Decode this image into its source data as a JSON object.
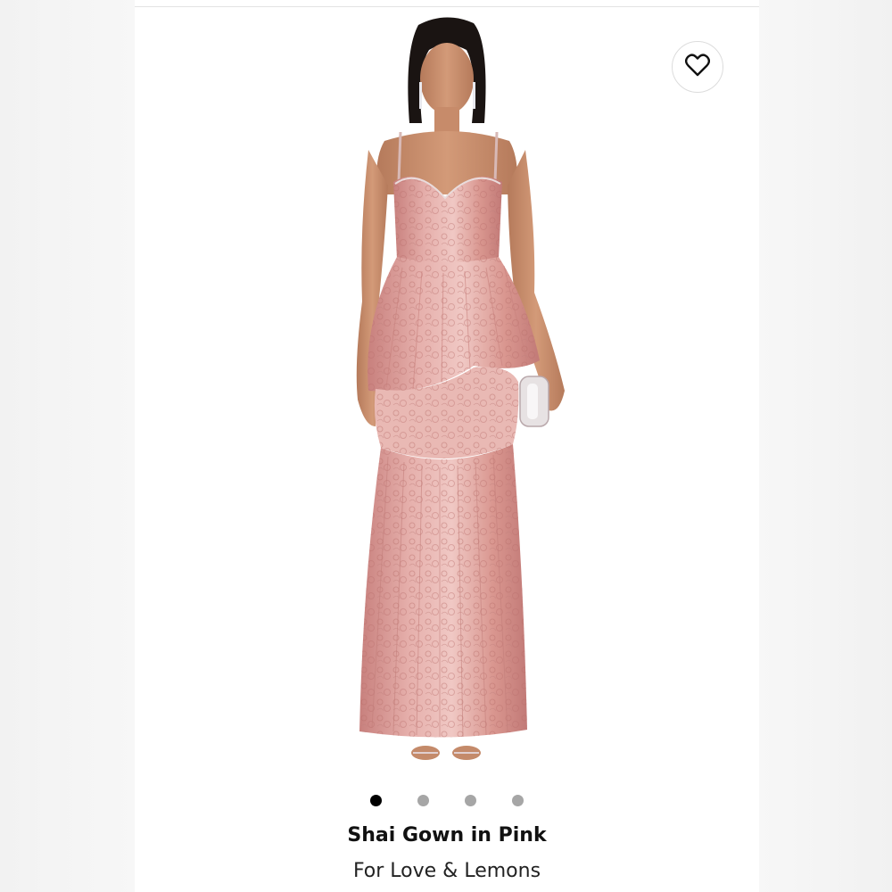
{
  "product": {
    "title": "Shai Gown in Pink",
    "brand": "For Love & Lemons",
    "image_alt": "Model wearing pink lace tiered gown"
  },
  "gallery": {
    "dots": [
      {
        "state": "active"
      },
      {
        "state": "inactive"
      },
      {
        "state": "inactive"
      },
      {
        "state": "inactive"
      }
    ]
  },
  "icons": {
    "favorite": "heart-icon"
  },
  "colors": {
    "dress": "#d99c9a",
    "dress_light": "#eec3c0",
    "dress_dark": "#b9716f",
    "skin": "#c98d6c",
    "dot_active": "#000000",
    "dot_inactive": "#a6a6a6"
  }
}
